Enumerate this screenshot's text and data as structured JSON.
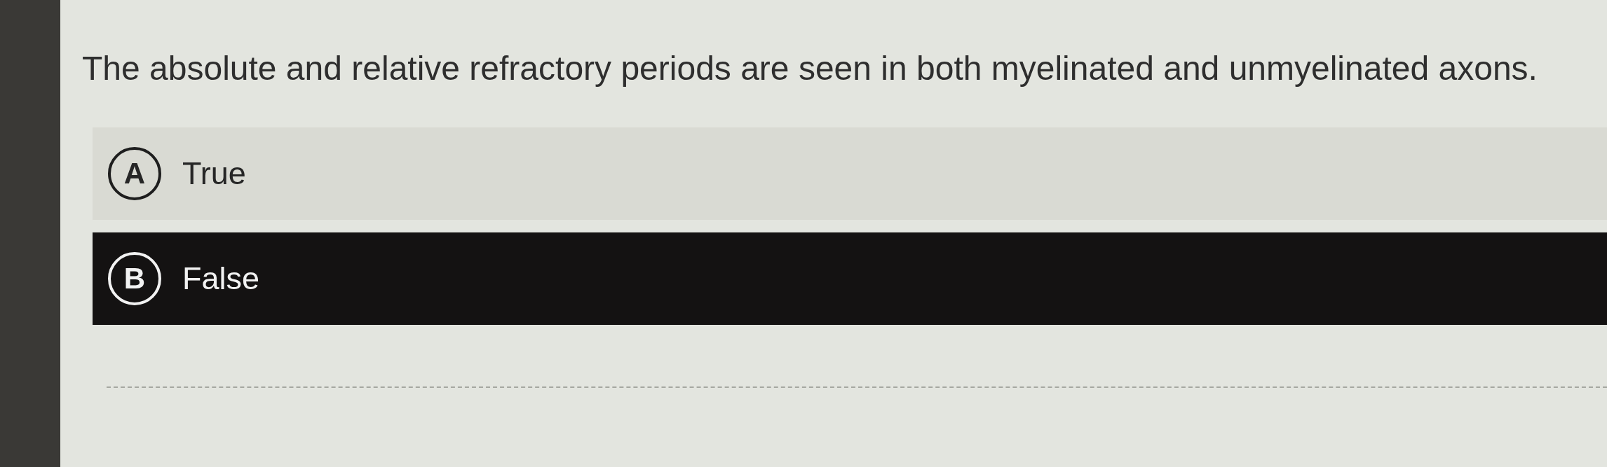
{
  "question": {
    "text": "The absolute and relative refractory periods are seen in both myelinated and unmyelinated axons."
  },
  "options": [
    {
      "letter": "A",
      "label": "True",
      "selected": false
    },
    {
      "letter": "B",
      "label": "False",
      "selected": true
    }
  ]
}
